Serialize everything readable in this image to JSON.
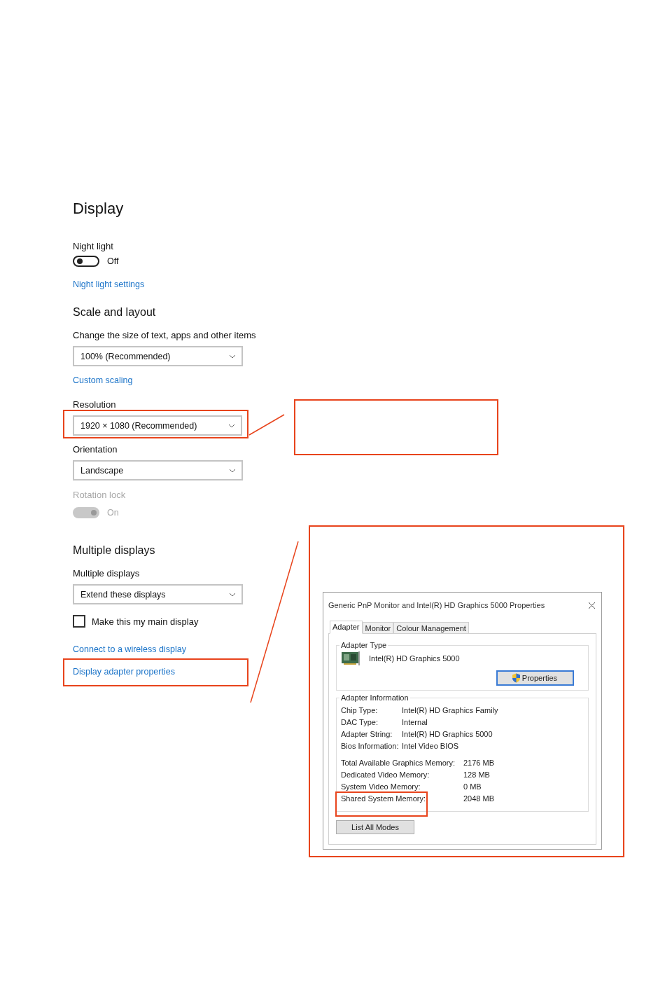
{
  "settings": {
    "title": "Display",
    "night_light": {
      "label": "Night light",
      "on": false,
      "disabled": false,
      "state": "Off"
    },
    "night_light_link": "Night light settings",
    "scale_heading": "Scale and layout",
    "scale": {
      "label": "Change the size of text, apps and other items",
      "value": "100% (Recommended)",
      "highlighted": false
    },
    "custom_scaling_link": "Custom scaling",
    "resolution": {
      "label": "Resolution",
      "value": "1920 × 1080 (Recommended)",
      "highlighted": true
    },
    "orientation": {
      "label": "Orientation",
      "value": "Landscape",
      "highlighted": false
    },
    "rotation_lock": {
      "label": "Rotation lock",
      "on": true,
      "disabled": true,
      "state": "On"
    },
    "multi_heading": "Multiple displays",
    "multiple_displays": {
      "label": "Multiple displays",
      "value": "Extend these displays",
      "highlighted": false
    },
    "main_display": {
      "label": "Make this my main display",
      "checked": false
    },
    "links": [
      {
        "label": "Connect to a wireless display",
        "highlighted": false
      },
      {
        "label": "Display adapter properties",
        "highlighted": true
      }
    ]
  },
  "dialog": {
    "title": "Generic PnP Monitor and Intel(R) HD Graphics 5000 Properties",
    "tabs": [
      {
        "label": "Adapter",
        "selected": true
      },
      {
        "label": "Monitor",
        "selected": false
      },
      {
        "label": "Colour Management",
        "selected": false
      }
    ],
    "adapter_type": {
      "legend": "Adapter Type",
      "name": "Intel(R) HD Graphics 5000",
      "button": "Properties"
    },
    "adapter_information": {
      "legend": "Adapter Information",
      "rows": [
        {
          "label": "Chip Type:",
          "value": "Intel(R) HD Graphics Family"
        },
        {
          "label": "DAC Type:",
          "value": "Internal"
        },
        {
          "label": "Adapter String:",
          "value": "Intel(R) HD Graphics 5000"
        },
        {
          "label": "Bios Information:",
          "value": "Intel Video BIOS"
        }
      ],
      "memory_rows": [
        {
          "label": "Total Available Graphics Memory:",
          "value": "2176 MB",
          "highlighted": false
        },
        {
          "label": "Dedicated Video Memory:",
          "value": "128 MB",
          "highlighted": false
        },
        {
          "label": "System Video Memory:",
          "value": "0 MB",
          "highlighted": false
        },
        {
          "label": "Shared System Memory:",
          "value": "2048 MB",
          "highlighted": true
        }
      ]
    },
    "button": "List All Modes"
  }
}
